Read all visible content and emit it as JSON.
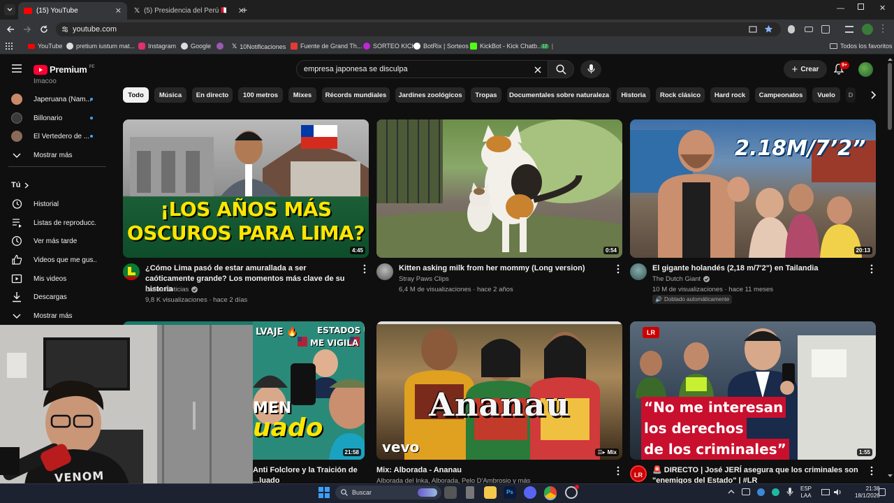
{
  "browser": {
    "tabs": [
      {
        "label": "(15) YouTube",
        "active": true
      },
      {
        "label": "(5) Presidencia del Perú 🇵🇪 (@p",
        "active": false
      }
    ],
    "new_tab": "+",
    "url": "youtube.com",
    "bookmarks": [
      "YouTube",
      "pretium iustum mat...",
      "Instagram",
      "Google",
      "10Notificaciones",
      "Fuente de Grand Th...",
      "SORTEO KICK",
      "BotRix | Sorteos",
      "KickBot - Kick Chatb...",
      "12",
      "Todos los favoritos"
    ]
  },
  "youtube": {
    "logo_text": "Premium",
    "country": "PE",
    "search_value": "empresa japonesa se disculpa",
    "create_label": "Crear",
    "notif_badge": "9+",
    "sidebar": {
      "cut_item": "Imacoo",
      "subscriptions": [
        {
          "label": "Japeruana (Nam...",
          "color": "#c98a6a"
        },
        {
          "label": "Billonario",
          "color": "#3a3a3a"
        },
        {
          "label": "El Vertedero de ...",
          "color": "#8a6a5a"
        }
      ],
      "show_more_1": "Mostrar más",
      "you_header": "Tú",
      "you_items": [
        {
          "label": "Historial",
          "icon": "history-icon"
        },
        {
          "label": "Listas de reproducc...",
          "icon": "playlist-icon"
        },
        {
          "label": "Ver más tarde",
          "icon": "clock-icon"
        },
        {
          "label": "Videos que me gus...",
          "icon": "thumb-up-icon"
        },
        {
          "label": "Mis videos",
          "icon": "my-videos-icon"
        },
        {
          "label": "Descargas",
          "icon": "download-icon"
        }
      ],
      "show_more_2": "Mostrar más"
    },
    "chips": [
      "Todo",
      "Música",
      "En directo",
      "100 metros",
      "Mixes",
      "Récords mundiales",
      "Jardines zoológicos",
      "Tropas",
      "Documentales sobre naturaleza",
      "Historia",
      "Rock clásico",
      "Hard rock",
      "Campeonatos",
      "Vuelo",
      "D"
    ],
    "videos": [
      {
        "title": "¿Cómo Lima pasó de estar amurallada a ser caóticamente grande? Los momentos más clave de su historia",
        "channel": "Latina Noticias",
        "verified": true,
        "meta": "9,8 K visualizaciones · hace 2 días",
        "duration": "4:45",
        "thumb_text_1": "¡LOS AÑOS MÁS",
        "thumb_text_2": "OSCUROS PARA LIMA?",
        "avatar_color": "#15803d"
      },
      {
        "title": "Kitten asking milk from her mommy (Long version)",
        "channel": "Stray Paws Clips",
        "verified": false,
        "meta": "6,4 M de visualizaciones · hace 2 años",
        "duration": "0:54",
        "avatar_color": "#6b6b6b"
      },
      {
        "title": "El gigante holandés (2,18 m/7'2\") en Tailandia",
        "channel": "The Dutch Giant",
        "verified": true,
        "meta": "10 M de visualizaciones · hace 11 meses",
        "badge": "Doblado automáticamente",
        "duration": "20:13",
        "thumb_text_1": "2.18M/7’2”",
        "avatar_color": "#4a6a7a"
      },
      {
        "title": "Anti Folclore y la Traición de",
        "title_2": "...luado",
        "duration": "21:58",
        "thumb_text_1": "ESTADOS UNIDOS",
        "thumb_text_2": "ME VIGILA",
        "thumb_text_3": "LVAJE 🔥",
        "thumb_text_4": "MEN",
        "thumb_text_5": "uado"
      },
      {
        "title": "Mix: Alborada - Ananau",
        "meta": "Alborada del Inka, Alborada, Pelo D'Ambrosio y más",
        "duration": "Mix",
        "thumb_text_1": "Ananau",
        "vevo": "vevo"
      },
      {
        "title": "🚨 DIRECTO | José JERÍ asegura que los criminales son",
        "title_2": "\"enemigos del Estado\" | #LR",
        "duration": "1:55",
        "avatar_text": "LR",
        "thumb_text_1": "“No me interesan",
        "thumb_text_2": "los derechos",
        "thumb_text_3": "de los criminales”"
      }
    ]
  },
  "webcam": {
    "shirt_text": "VENOM"
  },
  "taskbar": {
    "search_placeholder": "Buscar",
    "lang_1": "ESP",
    "lang_2": "LAA",
    "time": "21:38",
    "date": "18/1/2026"
  }
}
